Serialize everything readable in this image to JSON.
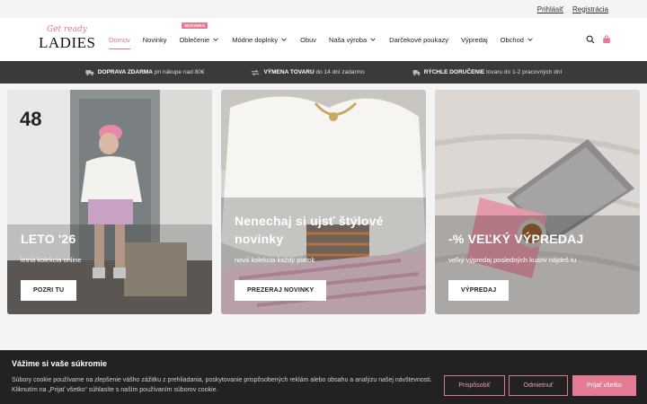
{
  "topbar": {
    "login": "Prihlásiť",
    "register": "Registrácia"
  },
  "logo": {
    "script": "Get ready",
    "word": "LADIES"
  },
  "nav": {
    "badge": "NOVINKA",
    "items": [
      {
        "label": "Domov"
      },
      {
        "label": "Novinky"
      },
      {
        "label": "Oblečenie"
      },
      {
        "label": "Módne doplnky"
      },
      {
        "label": "Obuv"
      },
      {
        "label": "Naša výroba"
      },
      {
        "label": "Darčekové poukazy"
      },
      {
        "label": "Výpredaj"
      },
      {
        "label": "Obchod"
      }
    ]
  },
  "promo": [
    {
      "strong": "DOPRAVA ZDARMA",
      "rest": " pri nákupe nad 80€"
    },
    {
      "strong": "VÝMENA TOVARU",
      "rest": " do 14 dní zadarmo"
    },
    {
      "strong": "RÝCHLE DORUČENIE",
      "rest": " tovaru do 1-2 pracovných dní"
    }
  ],
  "cards": [
    {
      "title_1": "LETO '26",
      "title_2": "",
      "subtitle": "letná kolekcia online",
      "button": "POZRI TU"
    },
    {
      "title_1": "Nenechaj si ujsť štýlové",
      "title_2": "novinky",
      "subtitle": "nová kolekcia každý piatok",
      "button": "PREZERAJ NOVINKY"
    },
    {
      "title_1": "-% VEĽKÝ VÝPREDAJ",
      "title_2": "",
      "subtitle": "veľký výpredaj posledných kusov nájdeš tu",
      "button": "VÝPREDAJ"
    }
  ],
  "cookie": {
    "title": "Vážime si vaše súkromie",
    "text": "Súbory cookie používame na zlepšenie vášho zážitku z prehliadania, poskytovanie prispôsobených reklám alebo obsahu a analýzu našej návštevnosti. Kliknutím na „Prijať všetko“ súhlasíte s naším používaním súborov cookie.",
    "customize": "Prispôsobiť",
    "reject": "Odmietnuť",
    "accept": "Prijať všetko"
  },
  "colors": {
    "accent": "#e47b92",
    "dark": "#3a3a3a"
  },
  "icons": [
    "search-icon",
    "bag-icon",
    "chevron-down-icon",
    "truck-icon",
    "exchange-icon",
    "fast-delivery-icon"
  ]
}
